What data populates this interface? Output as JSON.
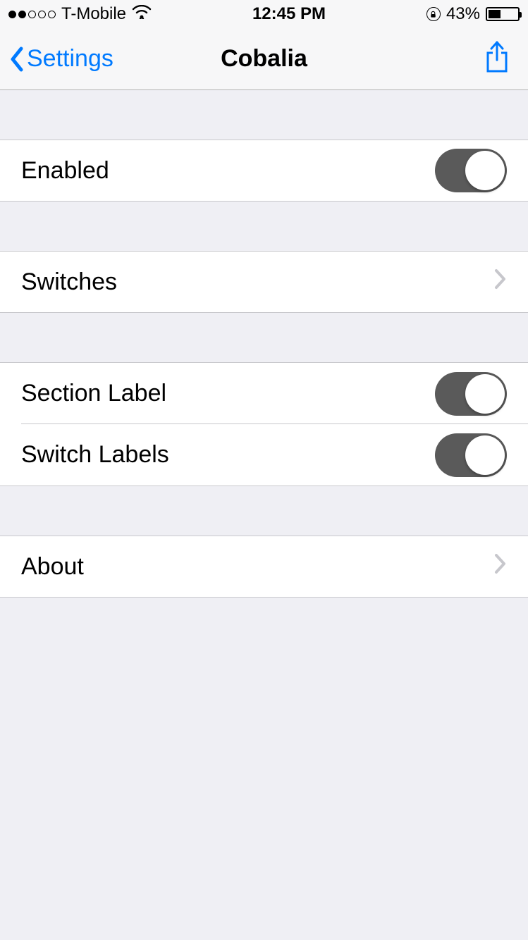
{
  "status": {
    "carrier": "T-Mobile",
    "time": "12:45 PM",
    "battery_pct": "43%"
  },
  "nav": {
    "back_label": "Settings",
    "title": "Cobalia"
  },
  "rows": {
    "enabled": "Enabled",
    "switches": "Switches",
    "section_label": "Section Label",
    "switch_labels": "Switch Labels",
    "about": "About"
  },
  "toggles": {
    "enabled": true,
    "section_label": true,
    "switch_labels": true
  }
}
